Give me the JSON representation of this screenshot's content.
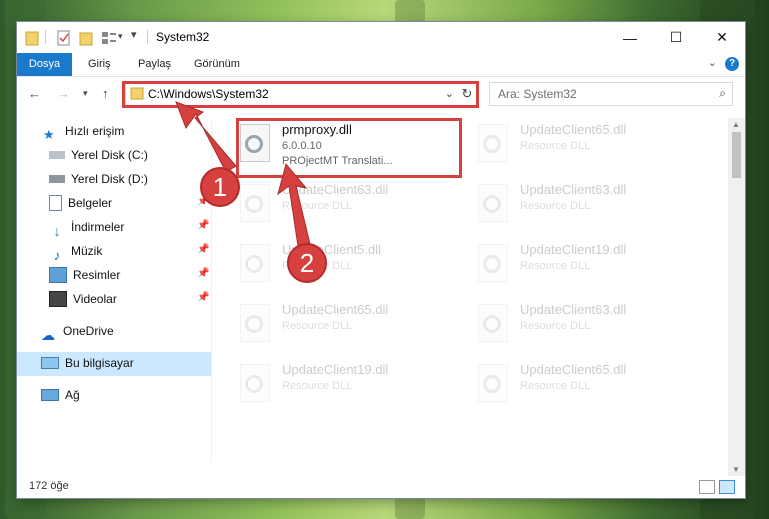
{
  "window": {
    "title": "System32"
  },
  "ribbon": {
    "tabs": [
      "Dosya",
      "Giriş",
      "Paylaş",
      "Görünüm"
    ]
  },
  "nav": {
    "address": "C:\\Windows\\System32",
    "search_placeholder": "Ara: System32"
  },
  "sidebar": {
    "items": [
      {
        "label": "Hızlı erişim",
        "icon": "star-icon"
      },
      {
        "label": "Yerel Disk (C:)",
        "icon": "drive-icon"
      },
      {
        "label": "Yerel Disk (D:)",
        "icon": "drive-icon"
      },
      {
        "label": "Belgeler",
        "icon": "documents-icon"
      },
      {
        "label": "İndirmeler",
        "icon": "download-icon"
      },
      {
        "label": "Müzik",
        "icon": "music-icon"
      },
      {
        "label": "Resimler",
        "icon": "pictures-icon"
      },
      {
        "label": "Videolar",
        "icon": "videos-icon"
      },
      {
        "label": "OneDrive",
        "icon": "cloud-icon"
      },
      {
        "label": "Bu bilgisayar",
        "icon": "computer-icon"
      },
      {
        "label": "Ağ",
        "icon": "network-icon"
      }
    ]
  },
  "files": {
    "highlighted": {
      "name": "prmproxy.dll",
      "version": "6.0.0.10",
      "description": "PROjectMT Translati..."
    },
    "left_column": [
      {
        "name": "UpdateClient63.dll",
        "description": "Resource DLL"
      },
      {
        "name": "UpdateClient5.dll",
        "description": "Resource DLL"
      },
      {
        "name": "UpdateClient65.dll",
        "description": "Resource DLL"
      },
      {
        "name": "UpdateClient19.dll",
        "description": "Resource DLL"
      }
    ],
    "right_column": [
      {
        "name": "UpdateClient65.dll",
        "description": "Resource DLL"
      },
      {
        "name": "UpdateClient63.dll",
        "description": "Resource DLL"
      },
      {
        "name": "UpdateClient19.dll",
        "description": "Resource DLL"
      },
      {
        "name": "UpdateClient63.dll",
        "description": "Resource DLL"
      },
      {
        "name": "UpdateClient65.dll",
        "description": "Resource DLL"
      }
    ]
  },
  "status": {
    "count": "172 öğe"
  },
  "markers": {
    "one": "1",
    "two": "2"
  },
  "colors": {
    "accent": "#1979ca",
    "annotation": "#d6413f",
    "selection": "#cce8ff"
  }
}
